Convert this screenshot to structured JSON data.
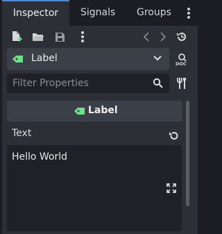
{
  "tabs": [
    {
      "label": "Inspector",
      "active": true
    },
    {
      "label": "Signals",
      "active": false
    },
    {
      "label": "Groups",
      "active": false
    }
  ],
  "object_selector": {
    "value": "Label",
    "icon": "label-tag-icon"
  },
  "filter": {
    "placeholder": "Filter Properties"
  },
  "section_header": {
    "label": "Label"
  },
  "property": {
    "name": "Text",
    "value": "Hello World"
  },
  "colors": {
    "accent": "#4d8ad6",
    "tag": "#6de08a"
  }
}
